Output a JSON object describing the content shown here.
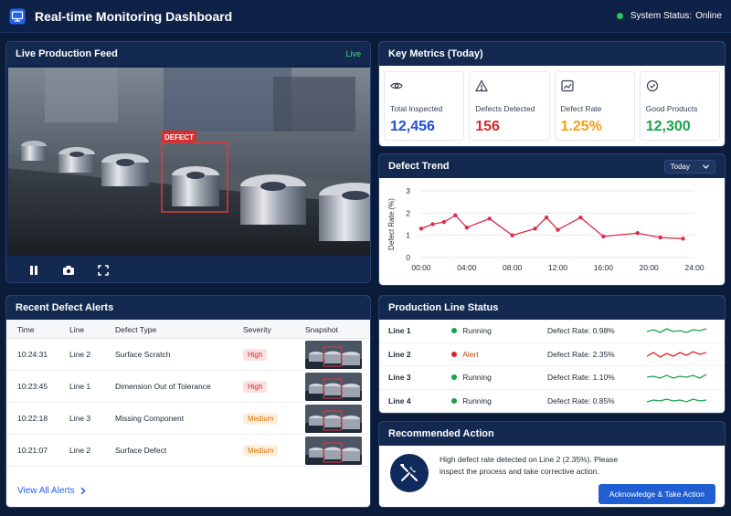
{
  "header": {
    "title": "Real-time Monitoring Dashboard",
    "status_label": "System Status:",
    "status_value": "Online"
  },
  "feed": {
    "title": "Live Production Feed",
    "live": "Live",
    "defect_tag": "DEFECT"
  },
  "metrics": {
    "title": "Key Metrics (Today)",
    "cards": [
      {
        "icon": "eye-icon",
        "label": "Total Inspected",
        "value": "12,456",
        "color": "#1d4ed8"
      },
      {
        "icon": "warning-icon",
        "label": "Defects Detected",
        "value": "156",
        "color": "#dc2626"
      },
      {
        "icon": "trend-icon",
        "label": "Defect Rate",
        "value": "1.25%",
        "color": "#f59e0b"
      },
      {
        "icon": "check-circle-icon",
        "label": "Good Products",
        "value": "12,300",
        "color": "#16a34a"
      }
    ]
  },
  "trend": {
    "title": "Defect Trend",
    "range_select": "Today"
  },
  "chart_data": {
    "type": "line",
    "title": "",
    "xlabel": "",
    "ylabel": "Defect Rate (%)",
    "x": [
      "00:00",
      "01:00",
      "02:00",
      "03:00",
      "04:00",
      "06:00",
      "08:00",
      "10:00",
      "11:00",
      "12:00",
      "14:00",
      "16:00",
      "19:00",
      "21:00",
      "23:00",
      "24:00"
    ],
    "x_ticks": [
      "00:00",
      "04:00",
      "08:00",
      "12:00",
      "16:00",
      "20:00",
      "24:00"
    ],
    "y": [
      1.3,
      1.5,
      1.6,
      1.9,
      1.35,
      1.75,
      1.0,
      1.3,
      1.8,
      1.25,
      1.8,
      0.95,
      1.1,
      0.9,
      0.85
    ],
    "y_ticks": [
      0,
      1,
      2,
      3
    ],
    "ylim": [
      0,
      3
    ],
    "grid": true,
    "color": "#dc2d4b"
  },
  "alerts": {
    "title": "Recent Defect Alerts",
    "columns": [
      "Time",
      "Line",
      "Defect Type",
      "Severity",
      "Snapshot"
    ],
    "rows": [
      {
        "time": "10:24:31",
        "line": "Line 2",
        "type": "Surface Scratch",
        "severity": "High"
      },
      {
        "time": "10:23:45",
        "line": "Line 1",
        "type": "Dimension Out of Tolerance",
        "severity": "High"
      },
      {
        "time": "10:22:18",
        "line": "Line 3",
        "type": "Missing Component",
        "severity": "Medium"
      },
      {
        "time": "10:21:07",
        "line": "Line 2",
        "type": "Surface Defect",
        "severity": "Medium"
      }
    ],
    "view_all": "View All Alerts"
  },
  "lines": {
    "title": "Production Line Status",
    "rows": [
      {
        "name": "Line 1",
        "status": "Running",
        "status_color": "#16a34a",
        "rate": "Defect Rate: 0.98%",
        "spark_color": "#16a34a"
      },
      {
        "name": "Line 2",
        "status": "Alert",
        "status_color": "#dc2626",
        "rate": "Defect Rate: 2.35%",
        "spark_color": "#dc2626"
      },
      {
        "name": "Line 3",
        "status": "Running",
        "status_color": "#16a34a",
        "rate": "Defect Rate: 1.10%",
        "spark_color": "#16a34a"
      },
      {
        "name": "Line 4",
        "status": "Running",
        "status_color": "#16a34a",
        "rate": "Defect Rate: 0.85%",
        "spark_color": "#16a34a"
      }
    ]
  },
  "recommendation": {
    "title": "Recommended Action",
    "text": "High defect rate detected on Line 2 (2.35%). Please inspect the process and take corrective action.",
    "button": "Acknowledge & Take Action"
  },
  "colors": {
    "accent": "#1f5fd1",
    "online": "#22c55e",
    "live": "#4ade80",
    "high_badge_bg": "#fde2e2",
    "high_badge_text": "#dc2626",
    "medium_badge_bg": "#fdeedd",
    "medium_badge_text": "#d97706"
  }
}
